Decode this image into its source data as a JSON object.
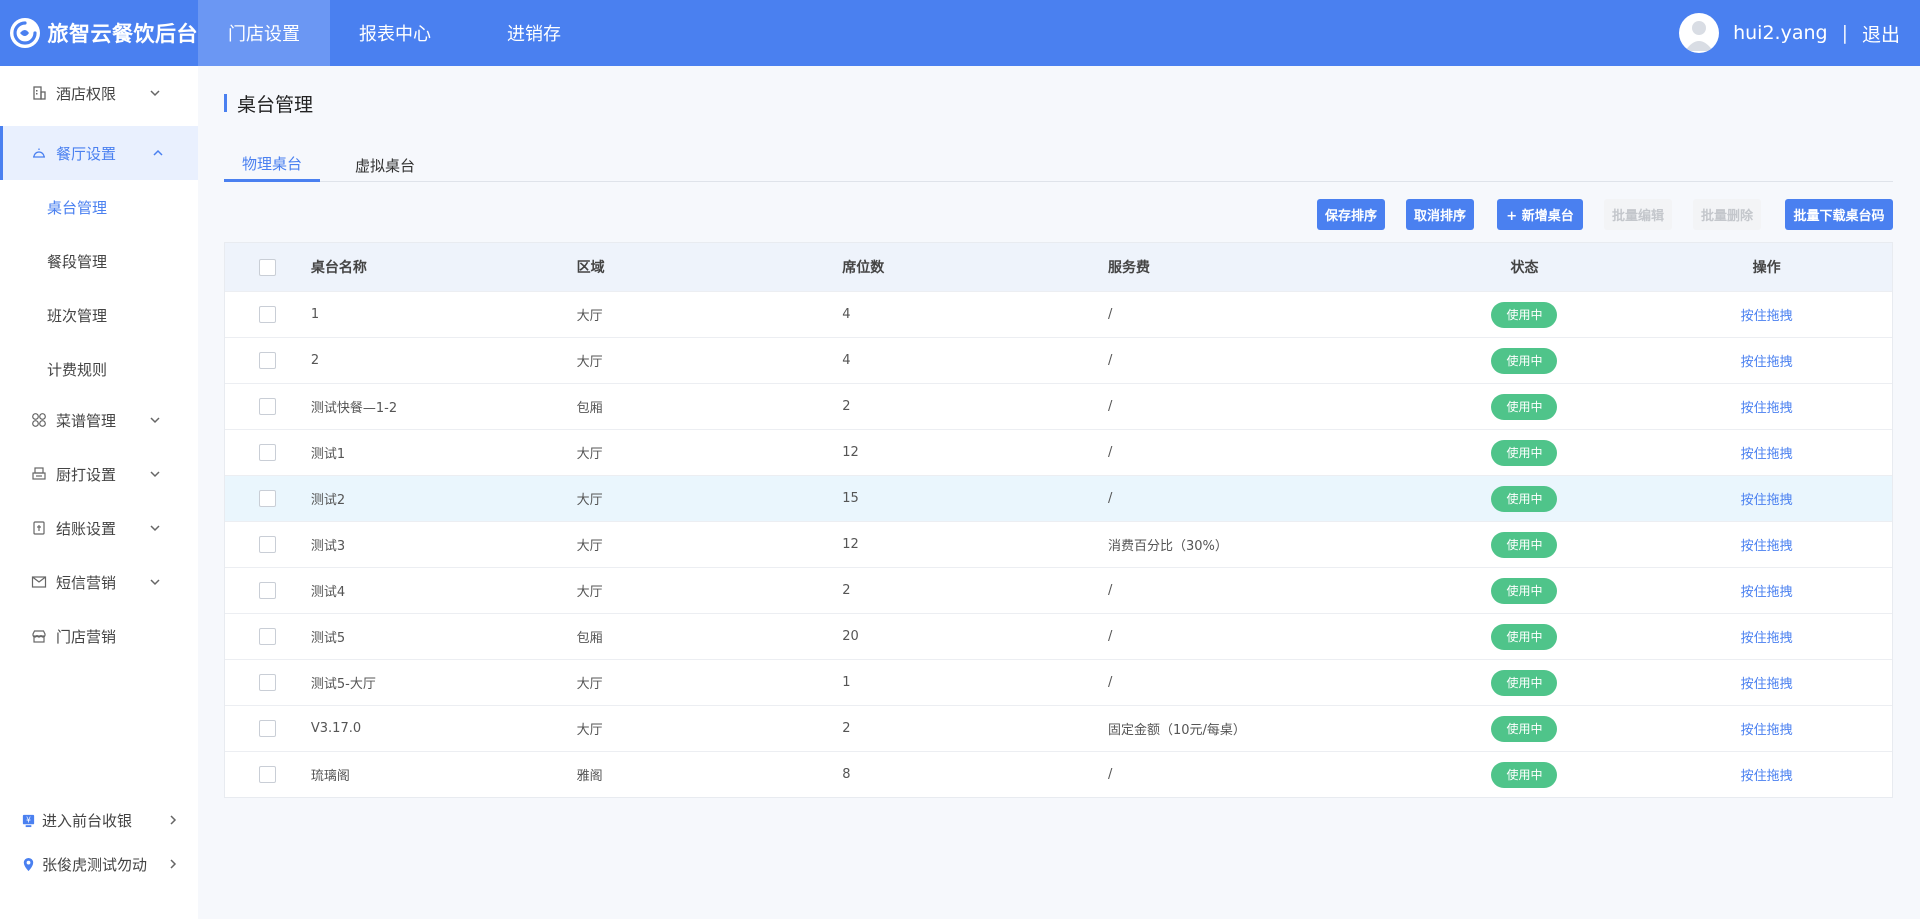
{
  "header": {
    "brand": "旅智云餐饮后台",
    "nav": [
      "门店设置",
      "报表中心",
      "进销存"
    ],
    "username": "hui2.yang",
    "separator": "|",
    "logout": "退出"
  },
  "sidebar": {
    "items": [
      {
        "label": "酒店权限",
        "icon": "hotel-icon"
      },
      {
        "label": "餐厅设置",
        "icon": "restaurant-icon"
      },
      {
        "label": "菜谱管理",
        "icon": "grid-icon"
      },
      {
        "label": "厨打设置",
        "icon": "printer-icon"
      },
      {
        "label": "结账设置",
        "icon": "checkout-icon"
      },
      {
        "label": "短信营销",
        "icon": "mail-icon"
      },
      {
        "label": "门店营销",
        "icon": "store-icon"
      }
    ],
    "sub_items": [
      "桌台管理",
      "餐段管理",
      "班次管理",
      "计费规则"
    ],
    "footer": [
      {
        "label": "进入前台收银",
        "icon": "cashier-icon"
      },
      {
        "label": "张俊虎测试勿动",
        "icon": "location-pin-icon"
      }
    ]
  },
  "page": {
    "title": "桌台管理",
    "tabs": [
      "物理桌台",
      "虚拟桌台"
    ]
  },
  "toolbar": {
    "save_sort": "保存排序",
    "cancel_sort": "取消排序",
    "add_table": "+ 新增桌台",
    "batch_edit": "批量编辑",
    "batch_delete": "批量删除",
    "batch_download": "批量下载桌台码"
  },
  "table": {
    "headers": [
      "桌台名称",
      "区域",
      "席位数",
      "服务费",
      "状态",
      "操作"
    ],
    "rows": [
      {
        "name": "1",
        "area": "大厅",
        "seats": "4",
        "fee": "/",
        "status": "使用中",
        "action": "按住拖拽"
      },
      {
        "name": "2",
        "area": "大厅",
        "seats": "4",
        "fee": "/",
        "status": "使用中",
        "action": "按住拖拽"
      },
      {
        "name": "测试快餐—1-2",
        "area": "包厢",
        "seats": "2",
        "fee": "/",
        "status": "使用中",
        "action": "按住拖拽"
      },
      {
        "name": "测试1",
        "area": "大厅",
        "seats": "12",
        "fee": "/",
        "status": "使用中",
        "action": "按住拖拽"
      },
      {
        "name": "测试2",
        "area": "大厅",
        "seats": "15",
        "fee": "/",
        "status": "使用中",
        "action": "按住拖拽"
      },
      {
        "name": "测试3",
        "area": "大厅",
        "seats": "12",
        "fee": "消费百分比（30%）",
        "status": "使用中",
        "action": "按住拖拽"
      },
      {
        "name": "测试4",
        "area": "大厅",
        "seats": "2",
        "fee": "/",
        "status": "使用中",
        "action": "按住拖拽"
      },
      {
        "name": "测试5",
        "area": "包厢",
        "seats": "20",
        "fee": "/",
        "status": "使用中",
        "action": "按住拖拽"
      },
      {
        "name": "测试5-大厅",
        "area": "大厅",
        "seats": "1",
        "fee": "/",
        "status": "使用中",
        "action": "按住拖拽"
      },
      {
        "name": "V3.17.0",
        "area": "大厅",
        "seats": "2",
        "fee": "固定金额（10元/每桌）",
        "status": "使用中",
        "action": "按住拖拽"
      },
      {
        "name": "琉璃阁",
        "area": "雅阁",
        "seats": "8",
        "fee": "/",
        "status": "使用中",
        "action": "按住拖拽"
      }
    ]
  },
  "colors": {
    "primary": "#4a80f0",
    "status_green": "#4fc48a",
    "header_bg": "#4a80f0"
  }
}
